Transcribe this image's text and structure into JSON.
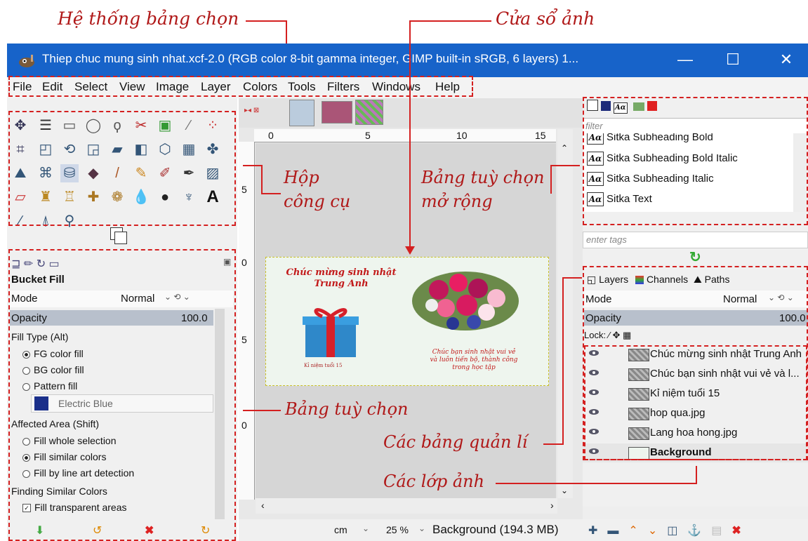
{
  "annotations": {
    "menu_system": "Hệ thống bảng chọn",
    "image_window": "Cửa sổ ảnh",
    "toolbox": "Hộp\ncông cụ",
    "toolbox_l1": "Hộp",
    "toolbox_l2": "công cụ",
    "ext_options_l1": "Bảng tuỳ chọn",
    "ext_options_l2": "mở rộng",
    "tool_options": "Bảng tuỳ chọn",
    "manager_panels": "Các bảng quản lí",
    "image_layers": "Các lớp ảnh"
  },
  "window": {
    "title": "Thiep chuc mung sinh nhat.xcf-2.0 (RGB color 8-bit gamma integer, GIMP built-in sRGB, 6 layers) 1...",
    "minimize": "—",
    "maximize": "☐",
    "close": "✕"
  },
  "menu": [
    "File",
    "Edit",
    "Select",
    "View",
    "Image",
    "Layer",
    "Colors",
    "Tools",
    "Filters",
    "Windows",
    "Help"
  ],
  "tool_options": {
    "tool_name": "Bucket Fill",
    "mode_label": "Mode",
    "mode_value": "Normal",
    "opacity_label": "Opacity",
    "opacity_value": "100.0",
    "fill_type_label": "Fill Type  (Alt)",
    "fill_types": [
      "FG color fill",
      "BG color fill",
      "Pattern fill"
    ],
    "pattern_name": "Electric Blue",
    "affected_label": "Affected Area  (Shift)",
    "affected": [
      "Fill whole selection",
      "Fill similar colors",
      "Fill by line art detection"
    ],
    "finding_label": "Finding Similar Colors",
    "fill_transparent": "Fill transparent areas"
  },
  "canvas": {
    "ruler_top": [
      "0",
      "5",
      "10",
      "15"
    ],
    "ruler_left": [
      "5",
      "0",
      "5",
      "0"
    ],
    "card_title_l1": "Chúc mừng sinh nhật",
    "card_title_l2": "Trung Anh",
    "card_wish_l1": "Chúc bạn sinh nhật vui vẻ",
    "card_wish_l2": "và luôn tiến bộ, thành công",
    "card_wish_l3": "trong học tập",
    "card_memory": "Kỉ niệm tuổi 15",
    "status_unit": "cm",
    "status_zoom": "25 %",
    "status_info": "Background (194.3 MB)"
  },
  "fonts_panel": {
    "filter_placeholder": "filter",
    "fonts": [
      "Sitka Subheading Bold",
      "Sitka Subheading Bold Italic",
      "Sitka Subheading Italic",
      "Sitka Text"
    ],
    "tags_placeholder": "enter tags",
    "aa_glyph": "Aα"
  },
  "layers_panel": {
    "tabs": [
      "Layers",
      "Channels",
      "Paths"
    ],
    "mode_label": "Mode",
    "mode_value": "Normal",
    "opacity_label": "Opacity",
    "opacity_value": "100.0",
    "lock_label": "Lock:",
    "layers": [
      "Chúc mừng sinh nhật Trung Anh",
      "Chúc bạn sinh nhật vui vẻ và l...",
      "Kỉ niệm tuổi 15",
      "hop qua.jpg",
      "Lang hoa hong.jpg",
      "Background"
    ]
  },
  "colors": {
    "titlebar": "#1763c9",
    "annotation_red": "#b01818",
    "dash_red": "#d42020"
  }
}
